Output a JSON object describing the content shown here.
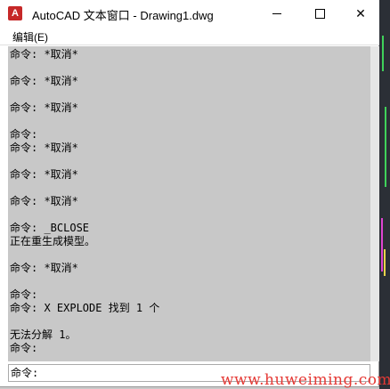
{
  "window": {
    "title": "AutoCAD 文本窗口 - Drawing1.dwg",
    "app_icon_text": "A",
    "close_glyph": "✕"
  },
  "menubar": {
    "items": [
      {
        "label": "编辑(E)"
      }
    ]
  },
  "history": {
    "lines": [
      "命令: *取消*",
      "",
      "命令: *取消*",
      "",
      "命令: *取消*",
      "",
      "命令:",
      "命令: *取消*",
      "",
      "命令: *取消*",
      "",
      "命令: *取消*",
      "",
      "命令: _BCLOSE",
      "正在重生成模型。",
      "",
      "命令: *取消*",
      "",
      "命令:",
      "命令: X EXPLODE 找到 1 个",
      "",
      "无法分解 1。",
      "命令:"
    ]
  },
  "command_line": {
    "prompt": "命令:",
    "value": ""
  },
  "watermark": "www.huweiming.com",
  "colors": {
    "history_bg": "#c8c8c8",
    "watermark": "#e53935"
  }
}
